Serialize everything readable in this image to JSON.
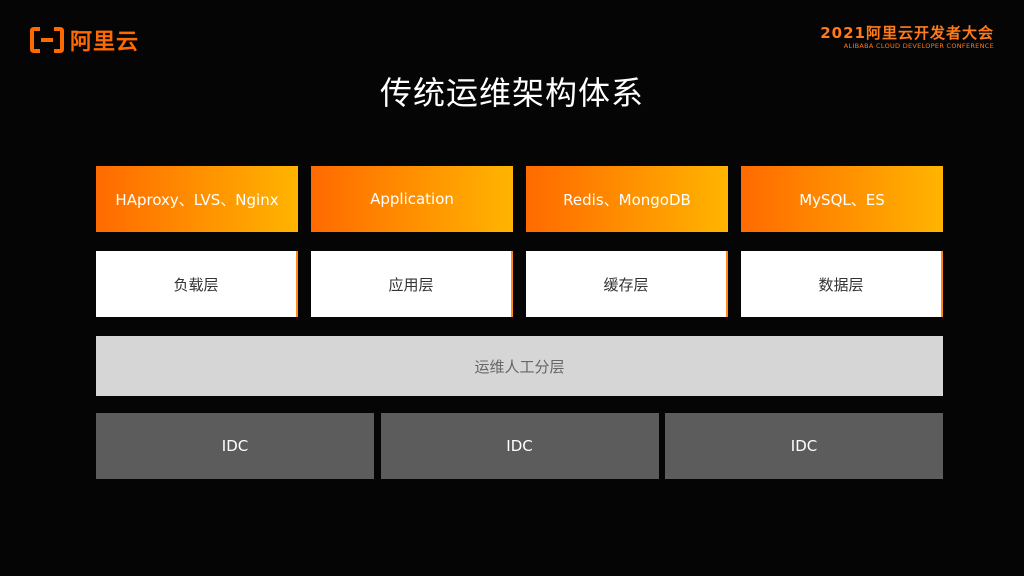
{
  "brand": {
    "logo_text": "阿里云",
    "conference_title": "2021阿里云开发者大会",
    "conference_subtitle": "ALIBABA CLOUD DEVELOPER CONFERENCE",
    "accent_color": "#ff6a00"
  },
  "slide": {
    "title": "传统运维架构体系"
  },
  "diagram": {
    "tech_row": [
      {
        "label": "HAproxy、LVS、Nginx"
      },
      {
        "label": "Application"
      },
      {
        "label": "Redis、MongoDB"
      },
      {
        "label": "MySQL、ES"
      }
    ],
    "layer_row": [
      {
        "label": "负载层"
      },
      {
        "label": "应用层"
      },
      {
        "label": "缓存层"
      },
      {
        "label": "数据层"
      }
    ],
    "ops_layer": {
      "label": "运维人工分层"
    },
    "idc_row": [
      {
        "label": "IDC"
      },
      {
        "label": "IDC"
      },
      {
        "label": "IDC"
      }
    ],
    "colors": {
      "tech_gradient_start": "#ff6a00",
      "tech_gradient_end": "#ffb400",
      "layer_bg": "#ffffff",
      "ops_bg": "#d6d6d6",
      "idc_bg": "#5c5c5c"
    }
  }
}
